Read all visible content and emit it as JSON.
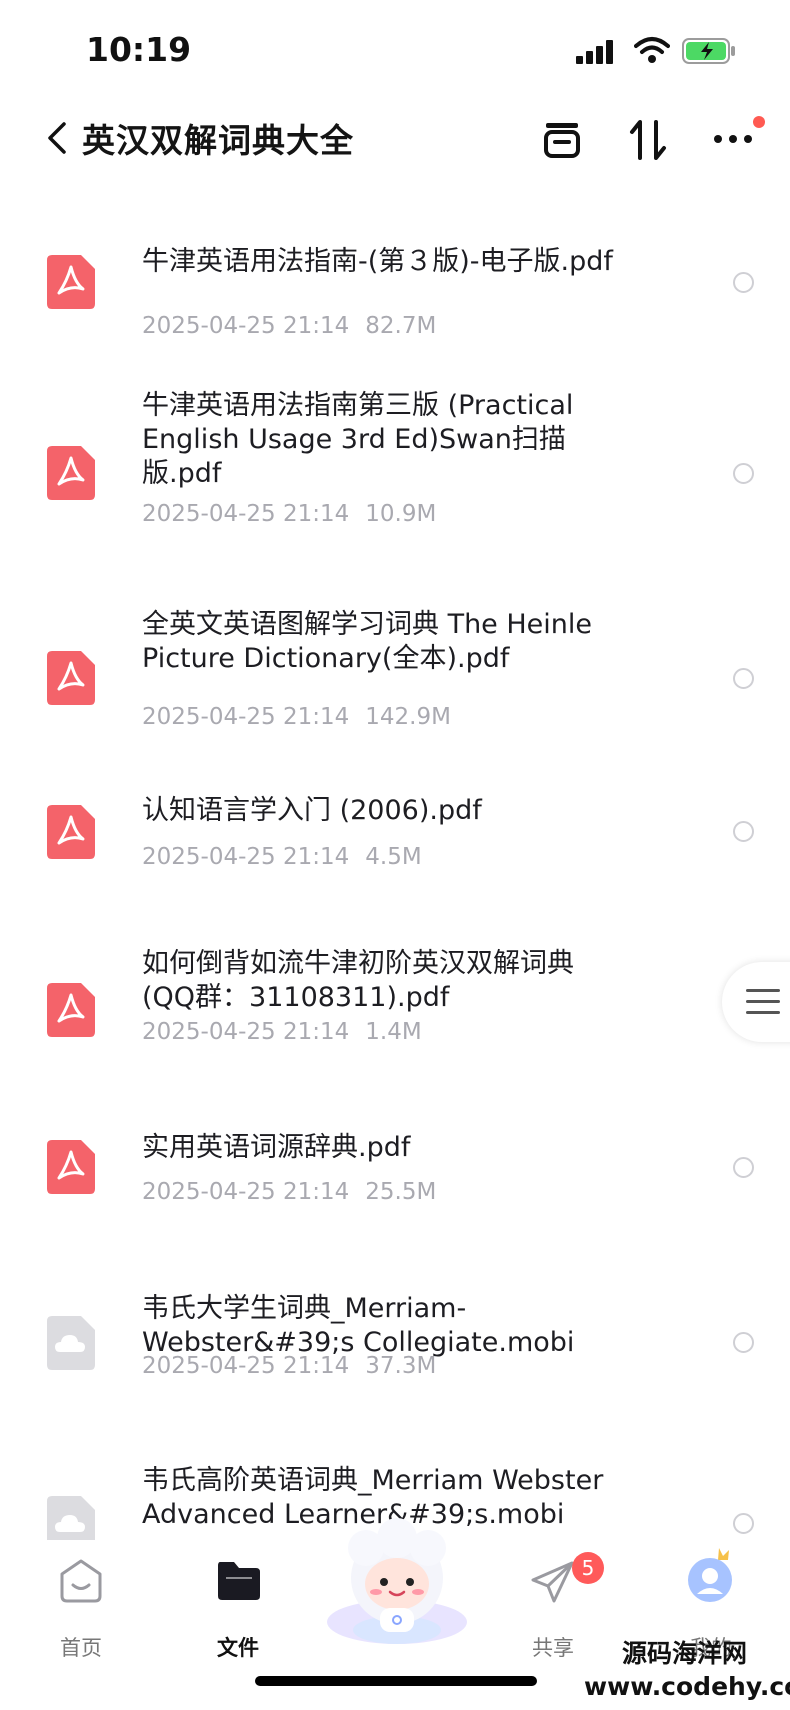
{
  "status_bar": {
    "time": "10:19"
  },
  "header": {
    "title": "英汉双解词典大全",
    "icons": [
      "back-chevron-icon",
      "archive-icon",
      "sort-icon",
      "more-icon"
    ]
  },
  "files": [
    {
      "name": "牛津英语用法指南-(第３版)-电子版.pdf",
      "date": "2025-04-25 21:14",
      "size": "82.7M",
      "type": "pdf"
    },
    {
      "name": "牛津英语用法指南第三版 (Practical English Usage 3rd Ed)Swan扫描版.pdf",
      "date": "2025-04-25 21:14",
      "size": "10.9M",
      "type": "pdf"
    },
    {
      "name": "全英文英语图解学习词典 The Heinle Picture Dictionary(全本).pdf",
      "date": "2025-04-25 21:14",
      "size": "142.9M",
      "type": "pdf"
    },
    {
      "name": "认知语言学入门 (2006).pdf",
      "date": "2025-04-25 21:14",
      "size": "4.5M",
      "type": "pdf"
    },
    {
      "name": "如何倒背如流牛津初阶英汉双解词典(QQ群：31108311).pdf",
      "date": "2025-04-25 21:14",
      "size": "1.4M",
      "type": "pdf"
    },
    {
      "name": "实用英语词源辞典.pdf",
      "date": "2025-04-25 21:14",
      "size": "25.5M",
      "type": "pdf"
    },
    {
      "name": "韦氏大学生词典_Merriam-Webster&#39;s Collegiate.mobi",
      "date": "2025-04-25 21:14",
      "size": "37.3M",
      "type": "cloud"
    },
    {
      "name": "韦氏高阶英语词典_Merriam Webster Advanced Learner&#39;s.mobi",
      "date": "",
      "size": "",
      "type": "cloud"
    }
  ],
  "bottom_nav": {
    "tabs": [
      {
        "label": "首页",
        "icon": "home-face-icon"
      },
      {
        "label": "文件",
        "icon": "folder-icon"
      },
      {
        "label": "共享",
        "icon": "paper-plane-icon",
        "badge": "5"
      },
      {
        "label": "我的",
        "icon": "avatar-crown-icon"
      }
    ]
  },
  "watermark": {
    "line1": "源码海洋网",
    "line2": "www.codehy.com"
  },
  "colors": {
    "pdf": "#f4636a",
    "cloud": "#dcdce0",
    "badge": "#ff5a5a",
    "accent": "#ff5a52"
  }
}
